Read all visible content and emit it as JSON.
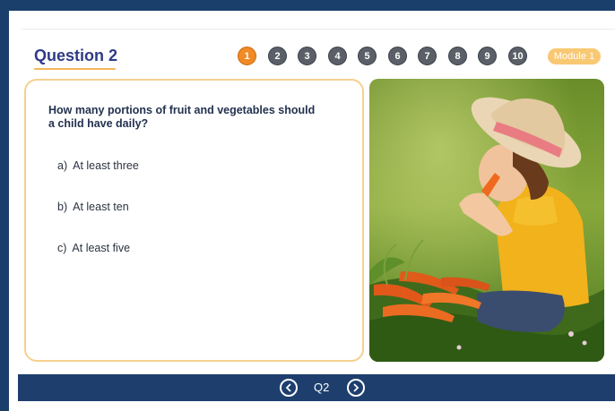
{
  "header": {
    "title": "Question 2",
    "module_badge": "Module 1"
  },
  "steps": [
    "1",
    "2",
    "3",
    "4",
    "5",
    "6",
    "7",
    "8",
    "9",
    "10"
  ],
  "active_step": "1",
  "question": {
    "text": "How many portions of fruit and vegetables should a child have daily?",
    "answers": [
      {
        "letter": "a)",
        "text": "At least three"
      },
      {
        "letter": "b)",
        "text": "At least ten"
      },
      {
        "letter": "c)",
        "text": "At least five"
      }
    ]
  },
  "navigation": {
    "label": "Q2",
    "prev_icon": "chevron-left-circle-icon",
    "next_icon": "chevron-right-circle-icon"
  },
  "colors": {
    "accent": "#f08a26",
    "brand": "#1e3f6e",
    "title": "#2e3a86",
    "box_border": "#f5d08d"
  }
}
